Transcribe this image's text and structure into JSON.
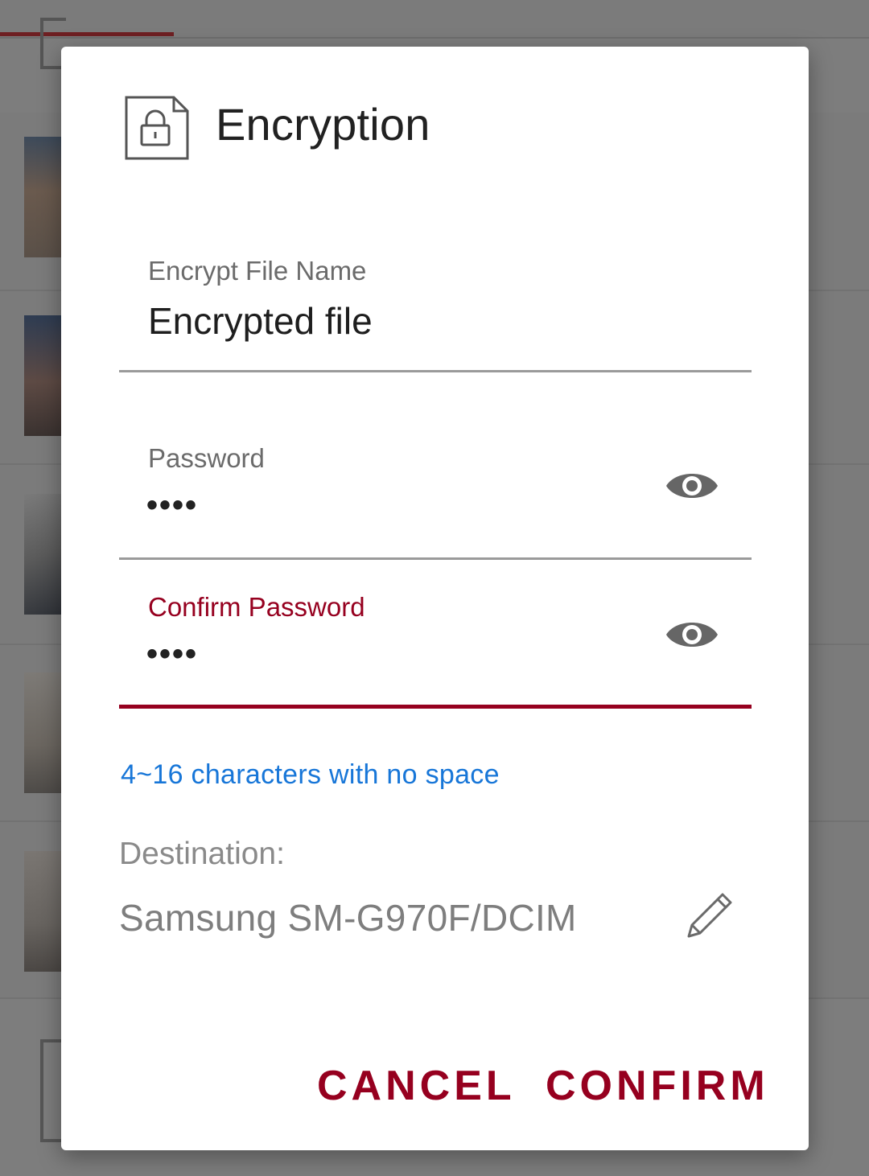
{
  "dialog": {
    "title": "Encryption",
    "title_icon": "locked-file-icon",
    "file_name": {
      "label": "Encrypt File Name",
      "value": "Encrypted file"
    },
    "password": {
      "label": "Password",
      "masked_value": "••••",
      "toggle_icon": "eye-icon"
    },
    "confirm_password": {
      "label": "Confirm Password",
      "masked_value": "••••",
      "toggle_icon": "eye-icon"
    },
    "hint": "4~16 characters with no space",
    "destination": {
      "label": "Destination:",
      "value": "Samsung SM-G970F/DCIM",
      "edit_icon": "pencil-icon"
    },
    "buttons": {
      "cancel": "CANCEL",
      "confirm": "CONFIRM"
    }
  },
  "colors": {
    "accent": "#96001f",
    "hint": "#1776d8",
    "overlay": "#7d7d7d"
  }
}
